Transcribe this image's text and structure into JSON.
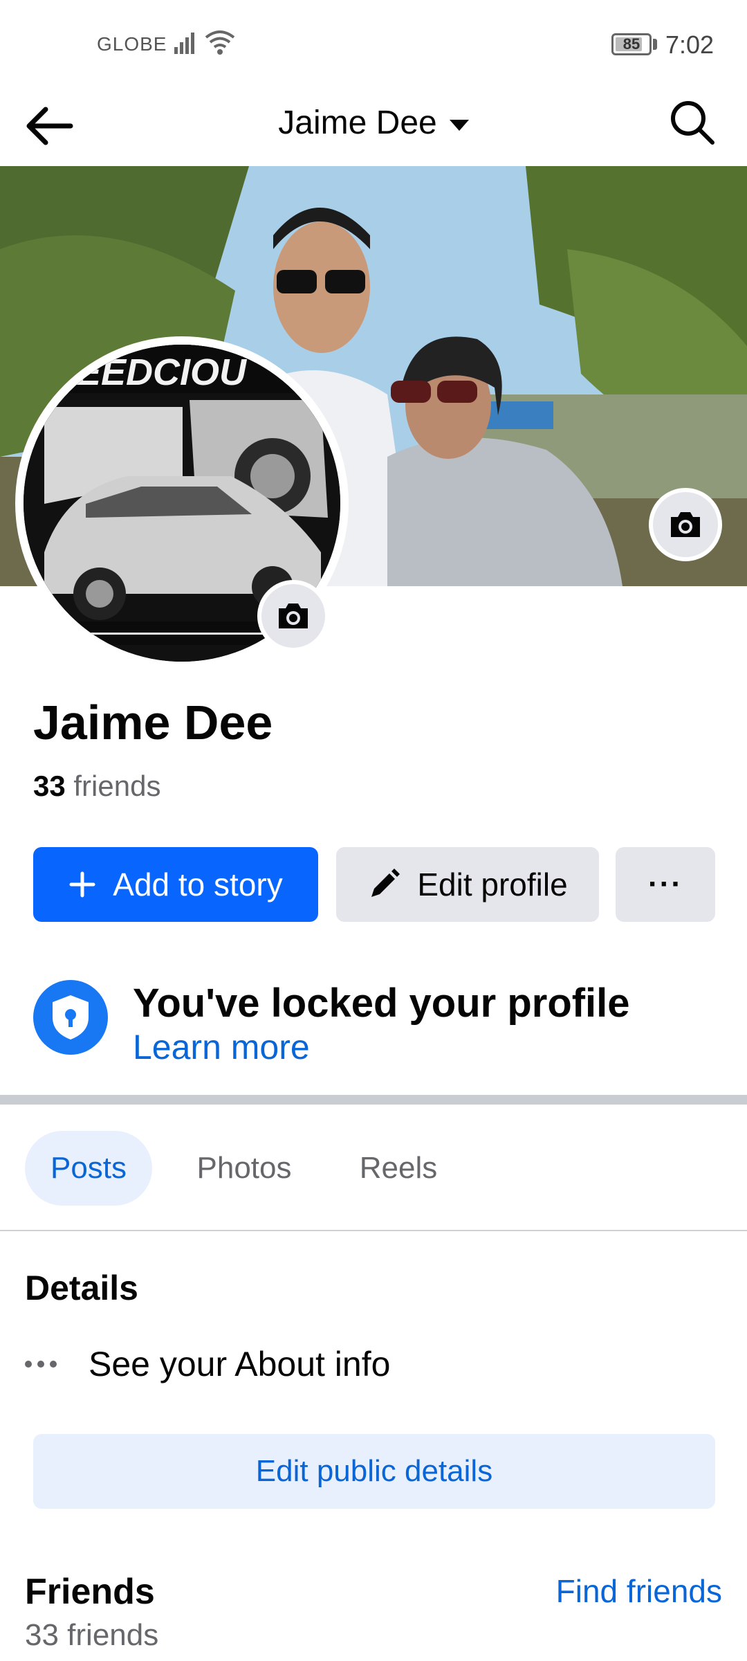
{
  "status_bar": {
    "carrier": "GLOBE",
    "battery": "85",
    "battery_fraction": 0.85,
    "time": "7:02"
  },
  "header": {
    "title": "Jaime Dee",
    "back_icon": "arrow-left-icon",
    "search_icon": "search-icon"
  },
  "profile": {
    "name": "Jaime Dee",
    "friend_count": "33",
    "friend_label": " friends"
  },
  "actions": {
    "add_story": "Add to story",
    "edit_profile": "Edit profile",
    "more": "···"
  },
  "lock_notice": {
    "title": "You've locked your profile",
    "link": "Learn more"
  },
  "tabs": [
    {
      "label": "Posts",
      "active": true
    },
    {
      "label": "Photos",
      "active": false
    },
    {
      "label": "Reels",
      "active": false
    }
  ],
  "details": {
    "title": "Details",
    "about": "See your About info",
    "edit_button": "Edit public details"
  },
  "friends": {
    "title": "Friends",
    "find_link": "Find friends",
    "count_text": "33 friends"
  },
  "colors": {
    "accent": "#0866ff",
    "link": "#0a66d6",
    "secondary_button": "#e4e6eb",
    "tab_active_bg": "#e7f0fc"
  }
}
